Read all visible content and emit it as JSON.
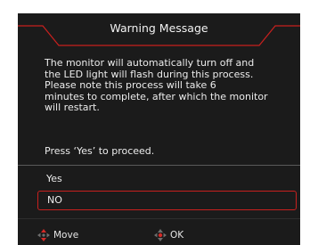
{
  "dialog": {
    "title": "Warning Message",
    "message": "The monitor will automatically turn off and\nthe LED light will flash during this process.\nPlease note this process will take 6\nminutes to complete, after which the monitor\nwill restart.",
    "prompt": "Press ‘Yes’ to proceed."
  },
  "options": {
    "yes_label": "Yes",
    "no_label": "NO",
    "selected": "NO"
  },
  "footer": {
    "move_label": "Move",
    "move_icon": "dpad-updown-icon",
    "ok_label": "OK",
    "ok_icon": "dpad-center-icon"
  },
  "colors": {
    "background": "#1b1b1b",
    "accent": "#c8201e",
    "text": "#ececec"
  }
}
